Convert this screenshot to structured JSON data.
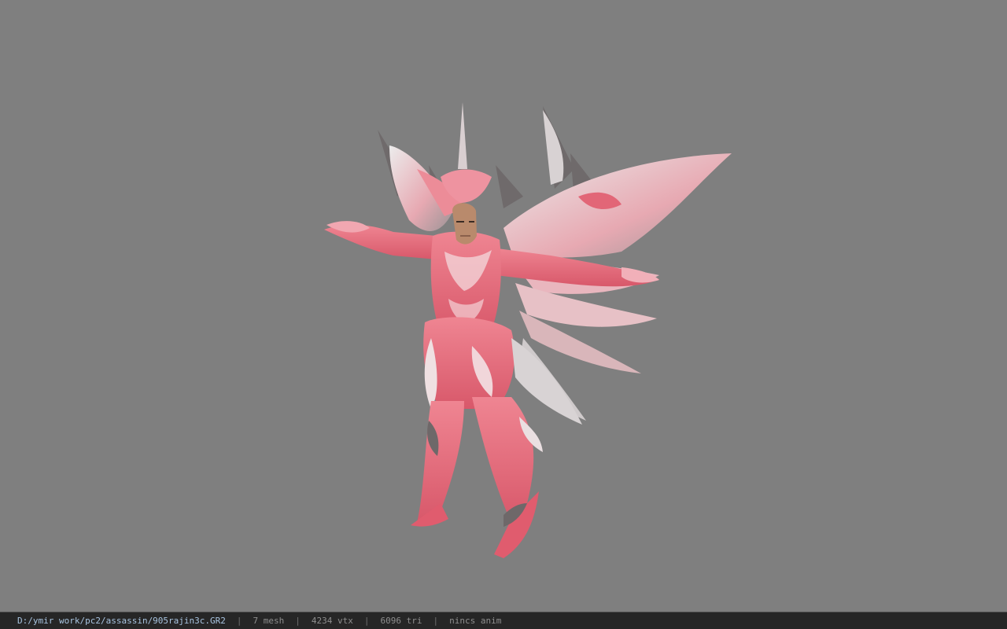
{
  "status": {
    "file_path": "D:/ymir work/pc2/assassin/905rajin3c.GR2",
    "separator": "|",
    "mesh_count": "7 mesh",
    "vertex_count": "4234 vtx",
    "triangle_count": "6096 tri",
    "animation": "nincs anim"
  },
  "colors": {
    "background": "#7f7f7f",
    "armor_pink": "#e8707e",
    "armor_light": "#f2d6da",
    "wing_silver": "#c9c3c4",
    "skin": "#b98a6c",
    "statusbar": "#262626"
  }
}
